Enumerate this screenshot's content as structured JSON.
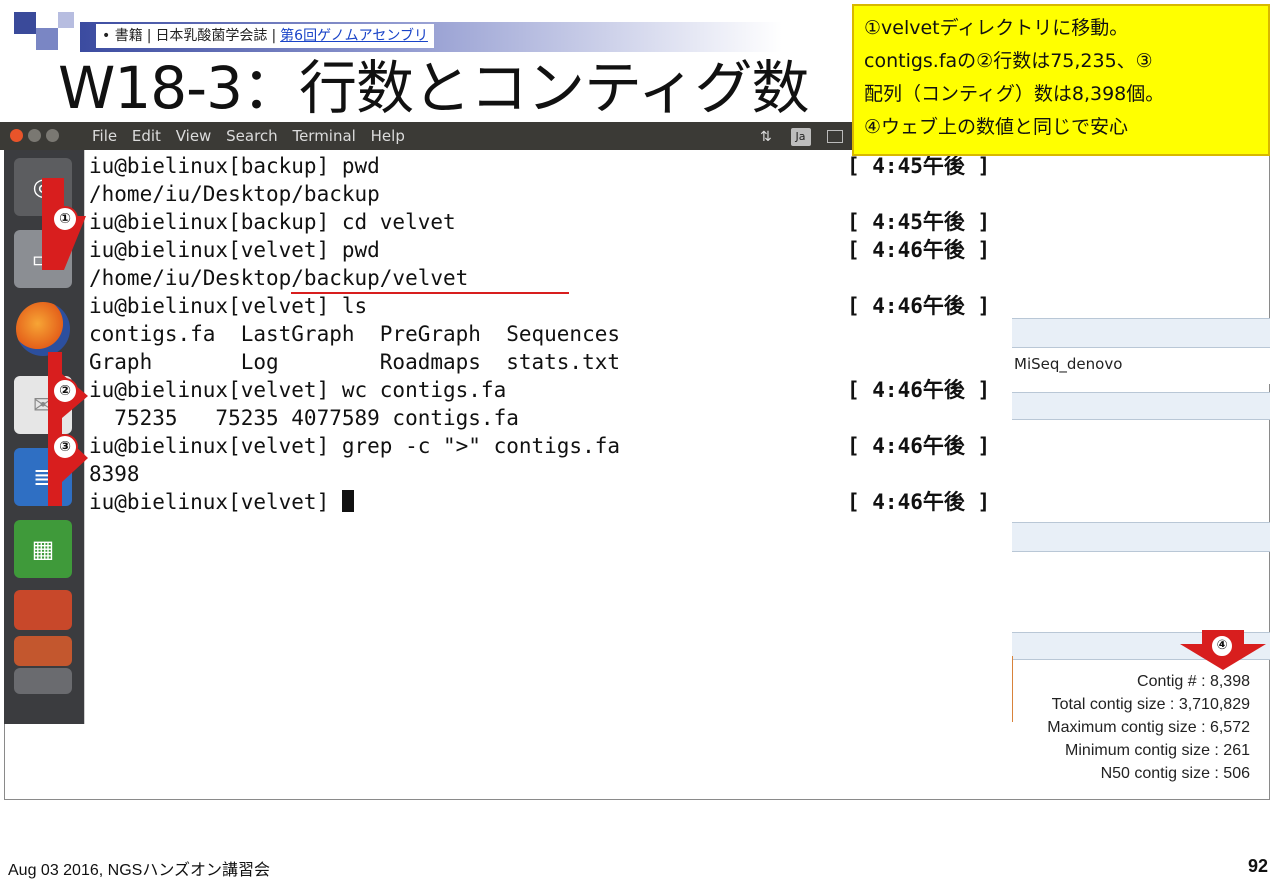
{
  "slide": {
    "breadcrumb": [
      "書籍",
      "日本乳酸菌学会誌",
      "第6回ゲノムアセンブリ"
    ],
    "title": "W18-3：行数とコンティグ数",
    "footer": "Aug 03 2016, NGSハンズオン講習会",
    "page_number": "92"
  },
  "callout": {
    "lines": [
      "①velvetディレクトリに移動。",
      "contigs.faの②行数は75,235、③",
      "配列（コンティグ）数は8,398個。",
      "④ウェブ上の数値と同じで安心"
    ]
  },
  "terminal": {
    "menu": [
      "File",
      "Edit",
      "View",
      "Search",
      "Terminal",
      "Help"
    ],
    "ime_label": "Ja",
    "lines": [
      {
        "text": "iu@bielinux[backup] pwd",
        "time": "[ 4:45午後 ]"
      },
      {
        "text": "/home/iu/Desktop/backup",
        "time": ""
      },
      {
        "text": "iu@bielinux[backup] cd velvet",
        "time": "[ 4:45午後 ]"
      },
      {
        "text": "iu@bielinux[velvet] pwd",
        "time": "[ 4:46午後 ]"
      },
      {
        "text": "/home/iu/Desktop/backup/velvet",
        "time": ""
      },
      {
        "text": "iu@bielinux[velvet] ls",
        "time": "[ 4:46午後 ]"
      },
      {
        "text": "contigs.fa  LastGraph  PreGraph  Sequences",
        "time": ""
      },
      {
        "text": "Graph       Log        Roadmaps  stats.txt",
        "time": ""
      },
      {
        "text": "iu@bielinux[velvet] wc contigs.fa",
        "time": "[ 4:46午後 ]"
      },
      {
        "text": "  75235   75235 4077589 contigs.fa",
        "time": ""
      },
      {
        "text": "iu@bielinux[velvet] grep -c \">\" contigs.fa",
        "time": "[ 4:46午後 ]"
      },
      {
        "text": "8398",
        "time": ""
      },
      {
        "text": "iu@bielinux[velvet] ",
        "time": "[ 4:46午後 ]"
      }
    ]
  },
  "markers": [
    "①",
    "②",
    "③",
    "④"
  ],
  "browser": {
    "job_name": "MiSeq_denovo",
    "stats": [
      "Contig #            : 8,398",
      "Total contig size   : 3,710,829",
      "Maximum contig size : 6,572",
      "Minimum contig size : 261",
      "N50 contig size     : 506"
    ]
  },
  "colors": {
    "callout_bg": "#ffff00",
    "arrow": "#d81e1e",
    "terminal_bar": "#3b3a36",
    "launcher": "#3b3c3f"
  }
}
